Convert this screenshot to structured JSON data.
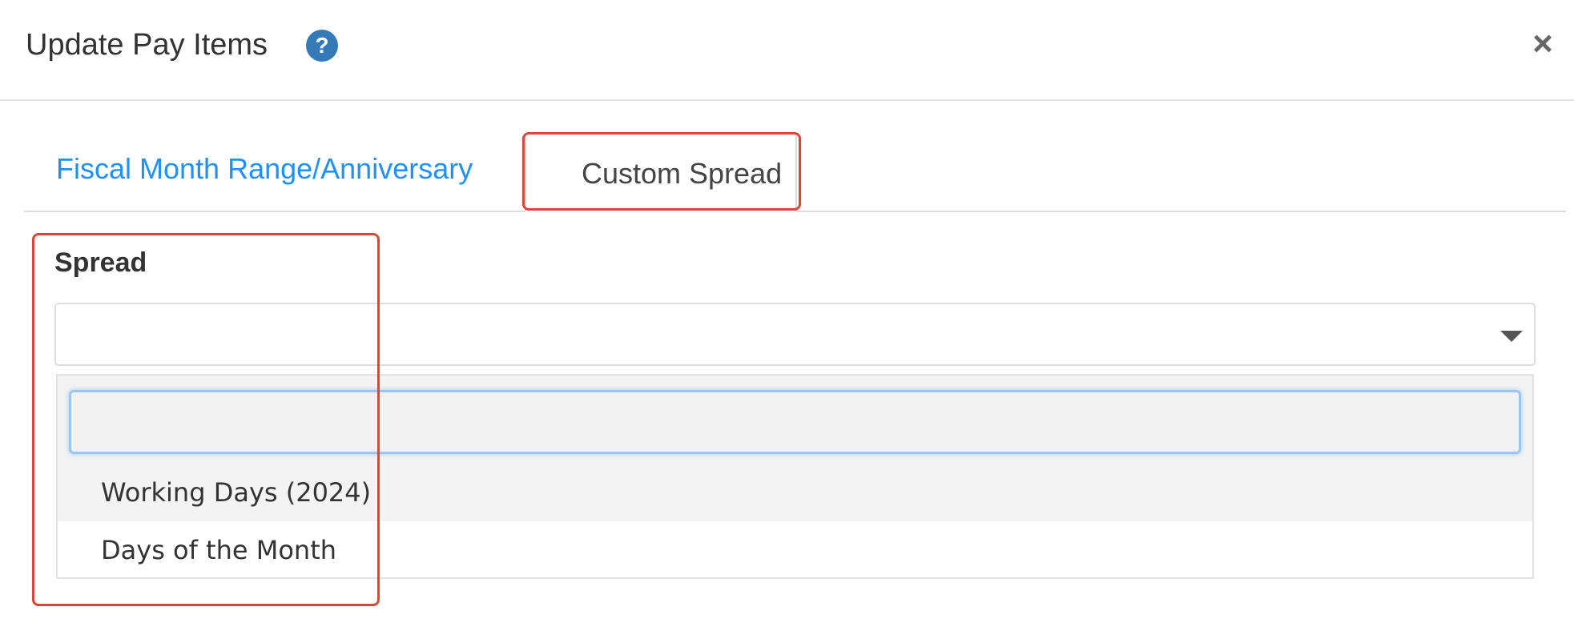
{
  "dialog": {
    "title": "Update Pay Items",
    "help_icon": "?",
    "close_icon": "×"
  },
  "tabs": [
    {
      "label": "Fiscal Month Range/Anniversary",
      "active": false,
      "color": "#1e90ff"
    },
    {
      "label": "Custom Spread",
      "active": true
    }
  ],
  "spread": {
    "label": "Spread",
    "selected_value": "",
    "search_value": "",
    "options": [
      {
        "label": "Working Days (2024)",
        "highlighted": true
      },
      {
        "label": "Days of the Month",
        "highlighted": false
      }
    ]
  },
  "annotation_color": "#d9473b"
}
